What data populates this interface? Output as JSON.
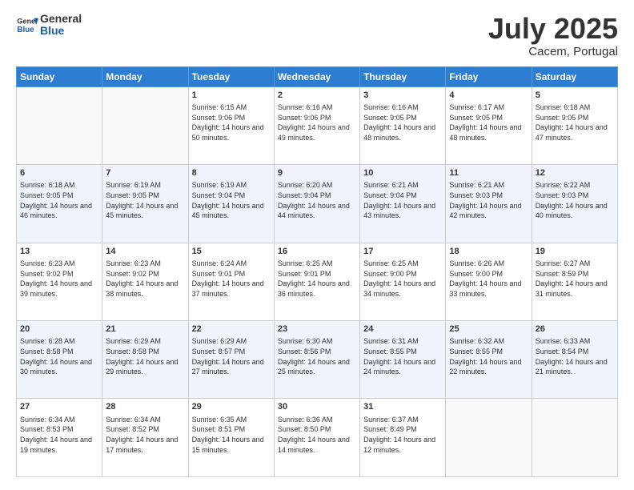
{
  "header": {
    "logo_general": "General",
    "logo_blue": "Blue",
    "month_title": "July 2025",
    "subtitle": "Cacem, Portugal"
  },
  "days_of_week": [
    "Sunday",
    "Monday",
    "Tuesday",
    "Wednesday",
    "Thursday",
    "Friday",
    "Saturday"
  ],
  "weeks": [
    [
      {
        "day": "",
        "info": ""
      },
      {
        "day": "",
        "info": ""
      },
      {
        "day": "1",
        "info": "Sunrise: 6:15 AM\nSunset: 9:06 PM\nDaylight: 14 hours and 50 minutes."
      },
      {
        "day": "2",
        "info": "Sunrise: 6:16 AM\nSunset: 9:06 PM\nDaylight: 14 hours and 49 minutes."
      },
      {
        "day": "3",
        "info": "Sunrise: 6:16 AM\nSunset: 9:05 PM\nDaylight: 14 hours and 48 minutes."
      },
      {
        "day": "4",
        "info": "Sunrise: 6:17 AM\nSunset: 9:05 PM\nDaylight: 14 hours and 48 minutes."
      },
      {
        "day": "5",
        "info": "Sunrise: 6:18 AM\nSunset: 9:05 PM\nDaylight: 14 hours and 47 minutes."
      }
    ],
    [
      {
        "day": "6",
        "info": "Sunrise: 6:18 AM\nSunset: 9:05 PM\nDaylight: 14 hours and 46 minutes."
      },
      {
        "day": "7",
        "info": "Sunrise: 6:19 AM\nSunset: 9:05 PM\nDaylight: 14 hours and 45 minutes."
      },
      {
        "day": "8",
        "info": "Sunrise: 6:19 AM\nSunset: 9:04 PM\nDaylight: 14 hours and 45 minutes."
      },
      {
        "day": "9",
        "info": "Sunrise: 6:20 AM\nSunset: 9:04 PM\nDaylight: 14 hours and 44 minutes."
      },
      {
        "day": "10",
        "info": "Sunrise: 6:21 AM\nSunset: 9:04 PM\nDaylight: 14 hours and 43 minutes."
      },
      {
        "day": "11",
        "info": "Sunrise: 6:21 AM\nSunset: 9:03 PM\nDaylight: 14 hours and 42 minutes."
      },
      {
        "day": "12",
        "info": "Sunrise: 6:22 AM\nSunset: 9:03 PM\nDaylight: 14 hours and 40 minutes."
      }
    ],
    [
      {
        "day": "13",
        "info": "Sunrise: 6:23 AM\nSunset: 9:02 PM\nDaylight: 14 hours and 39 minutes."
      },
      {
        "day": "14",
        "info": "Sunrise: 6:23 AM\nSunset: 9:02 PM\nDaylight: 14 hours and 38 minutes."
      },
      {
        "day": "15",
        "info": "Sunrise: 6:24 AM\nSunset: 9:01 PM\nDaylight: 14 hours and 37 minutes."
      },
      {
        "day": "16",
        "info": "Sunrise: 6:25 AM\nSunset: 9:01 PM\nDaylight: 14 hours and 36 minutes."
      },
      {
        "day": "17",
        "info": "Sunrise: 6:25 AM\nSunset: 9:00 PM\nDaylight: 14 hours and 34 minutes."
      },
      {
        "day": "18",
        "info": "Sunrise: 6:26 AM\nSunset: 9:00 PM\nDaylight: 14 hours and 33 minutes."
      },
      {
        "day": "19",
        "info": "Sunrise: 6:27 AM\nSunset: 8:59 PM\nDaylight: 14 hours and 31 minutes."
      }
    ],
    [
      {
        "day": "20",
        "info": "Sunrise: 6:28 AM\nSunset: 8:58 PM\nDaylight: 14 hours and 30 minutes."
      },
      {
        "day": "21",
        "info": "Sunrise: 6:29 AM\nSunset: 8:58 PM\nDaylight: 14 hours and 29 minutes."
      },
      {
        "day": "22",
        "info": "Sunrise: 6:29 AM\nSunset: 8:57 PM\nDaylight: 14 hours and 27 minutes."
      },
      {
        "day": "23",
        "info": "Sunrise: 6:30 AM\nSunset: 8:56 PM\nDaylight: 14 hours and 25 minutes."
      },
      {
        "day": "24",
        "info": "Sunrise: 6:31 AM\nSunset: 8:55 PM\nDaylight: 14 hours and 24 minutes."
      },
      {
        "day": "25",
        "info": "Sunrise: 6:32 AM\nSunset: 8:55 PM\nDaylight: 14 hours and 22 minutes."
      },
      {
        "day": "26",
        "info": "Sunrise: 6:33 AM\nSunset: 8:54 PM\nDaylight: 14 hours and 21 minutes."
      }
    ],
    [
      {
        "day": "27",
        "info": "Sunrise: 6:34 AM\nSunset: 8:53 PM\nDaylight: 14 hours and 19 minutes."
      },
      {
        "day": "28",
        "info": "Sunrise: 6:34 AM\nSunset: 8:52 PM\nDaylight: 14 hours and 17 minutes."
      },
      {
        "day": "29",
        "info": "Sunrise: 6:35 AM\nSunset: 8:51 PM\nDaylight: 14 hours and 15 minutes."
      },
      {
        "day": "30",
        "info": "Sunrise: 6:36 AM\nSunset: 8:50 PM\nDaylight: 14 hours and 14 minutes."
      },
      {
        "day": "31",
        "info": "Sunrise: 6:37 AM\nSunset: 8:49 PM\nDaylight: 14 hours and 12 minutes."
      },
      {
        "day": "",
        "info": ""
      },
      {
        "day": "",
        "info": ""
      }
    ]
  ]
}
